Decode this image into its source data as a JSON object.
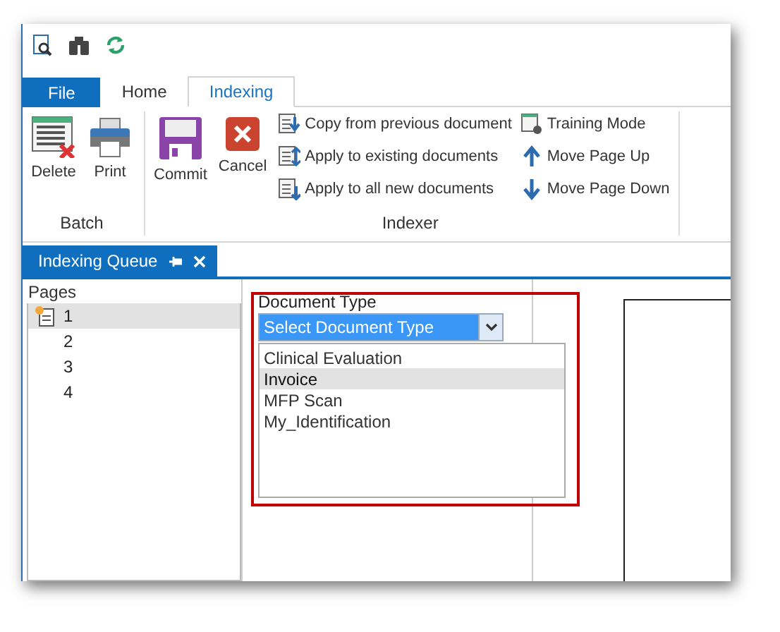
{
  "ribbon_tabs": [
    {
      "label": "File",
      "kind": "file",
      "selected": false
    },
    {
      "label": "Home",
      "kind": "tab",
      "selected": false
    },
    {
      "label": "Indexing",
      "kind": "tab",
      "selected": true
    }
  ],
  "ribbon_groups": [
    {
      "label": "Batch",
      "large_buttons": [
        "Delete",
        "Print"
      ]
    },
    {
      "label": "Indexer",
      "large_buttons": [
        "Commit",
        "Cancel"
      ],
      "small_columns": [
        [
          "Copy from previous document",
          "Apply to existing documents",
          "Apply to all new documents"
        ],
        [
          "Training Mode",
          "Move Page Up",
          "Move Page Down"
        ]
      ]
    }
  ],
  "dock_tab": {
    "label": "Indexing Queue"
  },
  "pages": {
    "label": "Pages",
    "items": [
      {
        "label": "1",
        "selected": true
      },
      {
        "label": "2",
        "selected": false
      },
      {
        "label": "3",
        "selected": false
      },
      {
        "label": "4",
        "selected": false
      }
    ]
  },
  "document_type": {
    "label": "Document Type",
    "value": "Select Document Type",
    "options": [
      {
        "label": "Clinical Evaluation",
        "selected": false
      },
      {
        "label": "Invoice",
        "selected": true
      },
      {
        "label": "MFP Scan",
        "selected": false
      },
      {
        "label": "My_Identification",
        "selected": false
      }
    ]
  }
}
